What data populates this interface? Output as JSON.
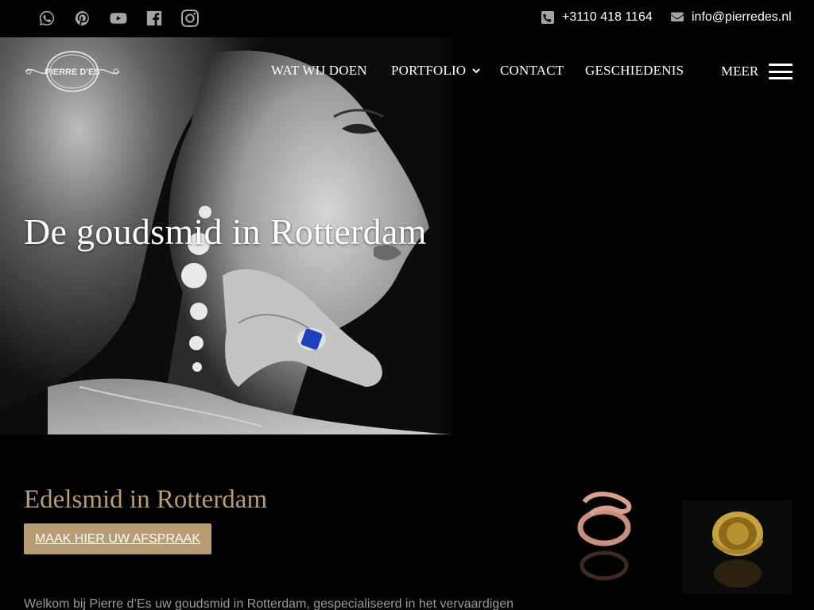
{
  "topbar": {
    "social_icons": [
      "whatsapp-icon",
      "pinterest-icon",
      "youtube-icon",
      "facebook-icon",
      "instagram-icon"
    ],
    "phone": "+3110 418 1164",
    "email": "info@pierredes.nl"
  },
  "header": {
    "logo_text": "PIERRE D'ES",
    "nav": {
      "wat_wij_doen": "WAT WIJ DOEN",
      "portfolio": "PORTFOLIO",
      "contact": "CONTACT",
      "geschiedenis": "GESCHIEDENIS",
      "meer": "MEER"
    }
  },
  "hero": {
    "title": "De goudsmid in Rotterdam"
  },
  "section": {
    "title": "Edelsmid in Rotterdam",
    "cta_label": "MAAK HIER UW AFSPRAAK",
    "intro": "Welkom bij Pierre d’Es uw goudsmid in Rotterdam, gespecialiseerd in het vervaardigen"
  },
  "colors": {
    "accent": "#b89c72",
    "icon_gray": "#a4a4a4",
    "background": "#000000"
  }
}
